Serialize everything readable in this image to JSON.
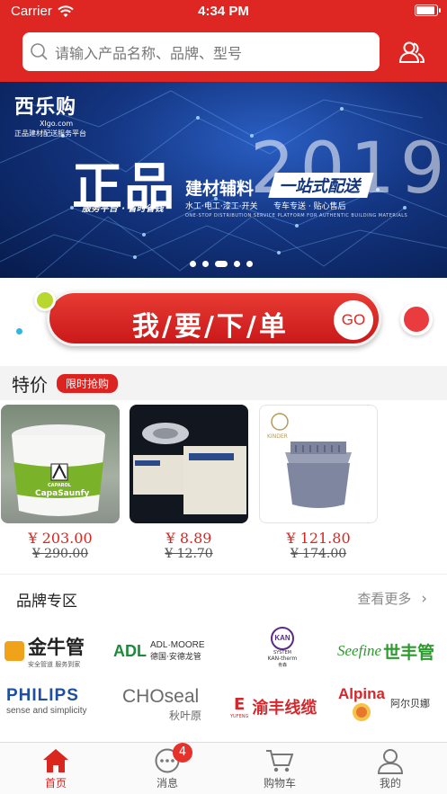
{
  "status_bar": {
    "carrier": "Carrier",
    "time": "4:34 PM"
  },
  "header": {
    "search_placeholder": "请输入产品名称、品牌、型号",
    "icon": "people-icon"
  },
  "banner": {
    "logo_name": "西乐购",
    "logo_site": "Xlgo.com",
    "logo_tag": "正品建材配送服务平台",
    "headline": "正品",
    "year": "2019",
    "subtitle": "建材辅料",
    "ribbon": "一站式配送",
    "slogan": "服务平台 · 省时省钱",
    "categories": "水工·电工·漆工·开关",
    "service": "专车专送 · 贴心售后",
    "english": "ONE-STOP DISTRIBUTION SERVICE PLATFORM FOR AUTHENTIC BUILDING MATERIALS",
    "slide_count": 5,
    "active_slide": 3
  },
  "order": {
    "label": "我/要/下/单",
    "go": "GO"
  },
  "special": {
    "title": "特价",
    "badge": "限时抢购",
    "products": [
      {
        "price": "¥ 203.00",
        "old_price": "¥ 290.00",
        "brand_text": "CAPAROL",
        "product_text": "CapaSaunfy"
      },
      {
        "price": "¥ 8.89",
        "old_price": "¥ 12.70"
      },
      {
        "price": "¥ 121.80",
        "old_price": "¥ 174.00",
        "brand_text": "KINDER"
      }
    ]
  },
  "brands": {
    "title": "品牌专区",
    "more": "查看更多",
    "items": [
      {
        "name": "金牛管",
        "sub": "安全管道  服务到家"
      },
      {
        "name": "ADL·MOORE",
        "sub": "德国·安德龙管",
        "mark": "ADL"
      },
      {
        "name": "KAN",
        "sub": "KAN-therm",
        "sub2": "SYSTEM",
        "sub3": "肯森"
      },
      {
        "name": "Seefine",
        "sub": "世丰管"
      },
      {
        "name": "PHILIPS",
        "sub": "sense and simplicity"
      },
      {
        "name": "CHOseal",
        "sub": "秋叶原"
      },
      {
        "name": "渝丰线缆",
        "sub": "YUFENG"
      },
      {
        "name": "Alpina",
        "sub": "阿尔贝娜"
      }
    ]
  },
  "tabbar": {
    "items": [
      {
        "label": "首页",
        "icon": "home-icon",
        "active": true
      },
      {
        "label": "消息",
        "icon": "message-icon",
        "badge": "4"
      },
      {
        "label": "购物车",
        "icon": "cart-icon"
      },
      {
        "label": "我的",
        "icon": "profile-icon"
      }
    ]
  },
  "colors": {
    "brand_red": "#de2722",
    "banner_blue": "#13347f"
  }
}
